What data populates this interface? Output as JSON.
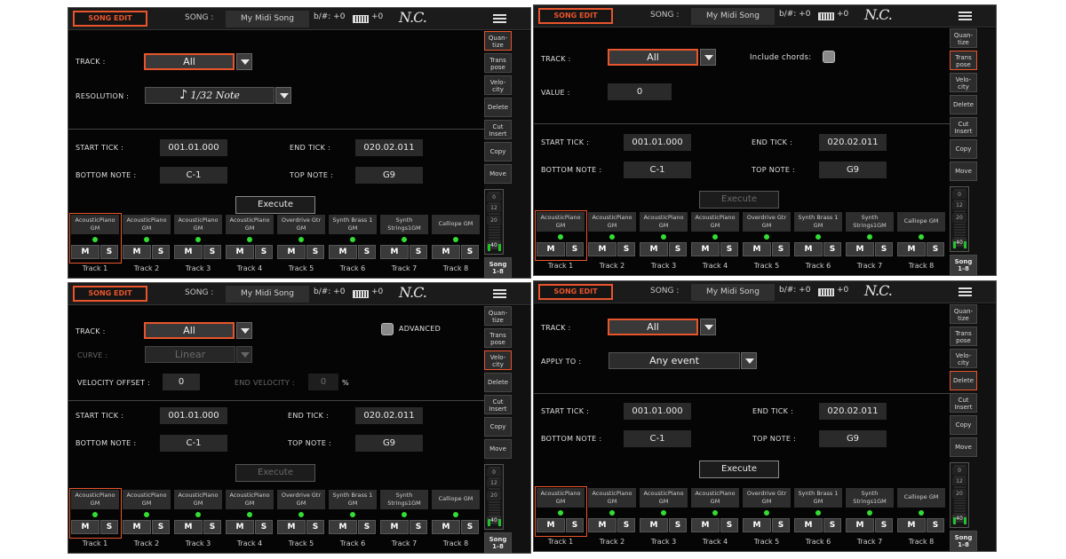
{
  "top": {
    "mode": "SONG EDIT",
    "song_label": "SONG :",
    "song_name": "My Midi Song",
    "key_text": "b/#: +0",
    "kbd_value": "+0",
    "chord": "N.C.",
    "menu_icon": "hamburger-menu-icon"
  },
  "side": {
    "quantize": "Quan-\ntize",
    "transpose": "Trans\npose",
    "velocity": "Velo-\ncity",
    "delete": "Delete",
    "cut_insert": "Cut\nInsert",
    "copy": "Copy",
    "move": "Move",
    "song_range": "Song\n1-8",
    "meter_ticks": [
      "0",
      "12",
      "20"
    ],
    "meter_level": "40"
  },
  "common": {
    "track_label": "TRACK :",
    "track_value": "All",
    "start_tick_label": "START TICK :",
    "start_tick": "001.01.000",
    "end_tick_label": "END TICK :",
    "end_tick": "020.02.011",
    "bottom_note_label": "BOTTOM NOTE :",
    "bottom_note": "C-1",
    "top_note_label": "TOP NOTE :",
    "top_note": "G9",
    "execute": "Execute"
  },
  "quantize": {
    "resolution_label": "RESOLUTION :",
    "resolution_note": "♪",
    "resolution_value": "1/32 Note"
  },
  "transpose": {
    "include_chords": "Include chords:",
    "value_label": "VALUE :",
    "value": "0"
  },
  "velocity": {
    "advanced": "ADVANCED",
    "curve_label": "CURVE :",
    "curve_value": "Linear",
    "offset_label": "VELOCITY OFFSET :",
    "offset_value": "0",
    "end_label": "END VELOCITY :",
    "end_value": "0",
    "percent": "%"
  },
  "delete": {
    "apply_label": "APPLY TO :",
    "apply_value": "Any event"
  },
  "tracks": [
    {
      "name1": "AcousticPiano",
      "name2": "GM",
      "label": "Track 1"
    },
    {
      "name1": "AcousticPiano",
      "name2": "GM",
      "label": "Track 2"
    },
    {
      "name1": "AcousticPiano",
      "name2": "GM",
      "label": "Track 3"
    },
    {
      "name1": "AcousticPiano",
      "name2": "GM",
      "label": "Track 4"
    },
    {
      "name1": "Overdrive Gtr",
      "name2": "GM",
      "label": "Track 5"
    },
    {
      "name1": "Synth Brass 1",
      "name2": "GM",
      "label": "Track 6"
    },
    {
      "name1": "Synth",
      "name2": "Strings1GM",
      "label": "Track 7"
    },
    {
      "name1": "Calliope GM",
      "name2": "",
      "label": "Track 8"
    }
  ],
  "m_label": "M",
  "s_label": "S",
  "colors": {
    "accent": "#e8552c",
    "led": "#33dd33",
    "background": "#050505"
  }
}
